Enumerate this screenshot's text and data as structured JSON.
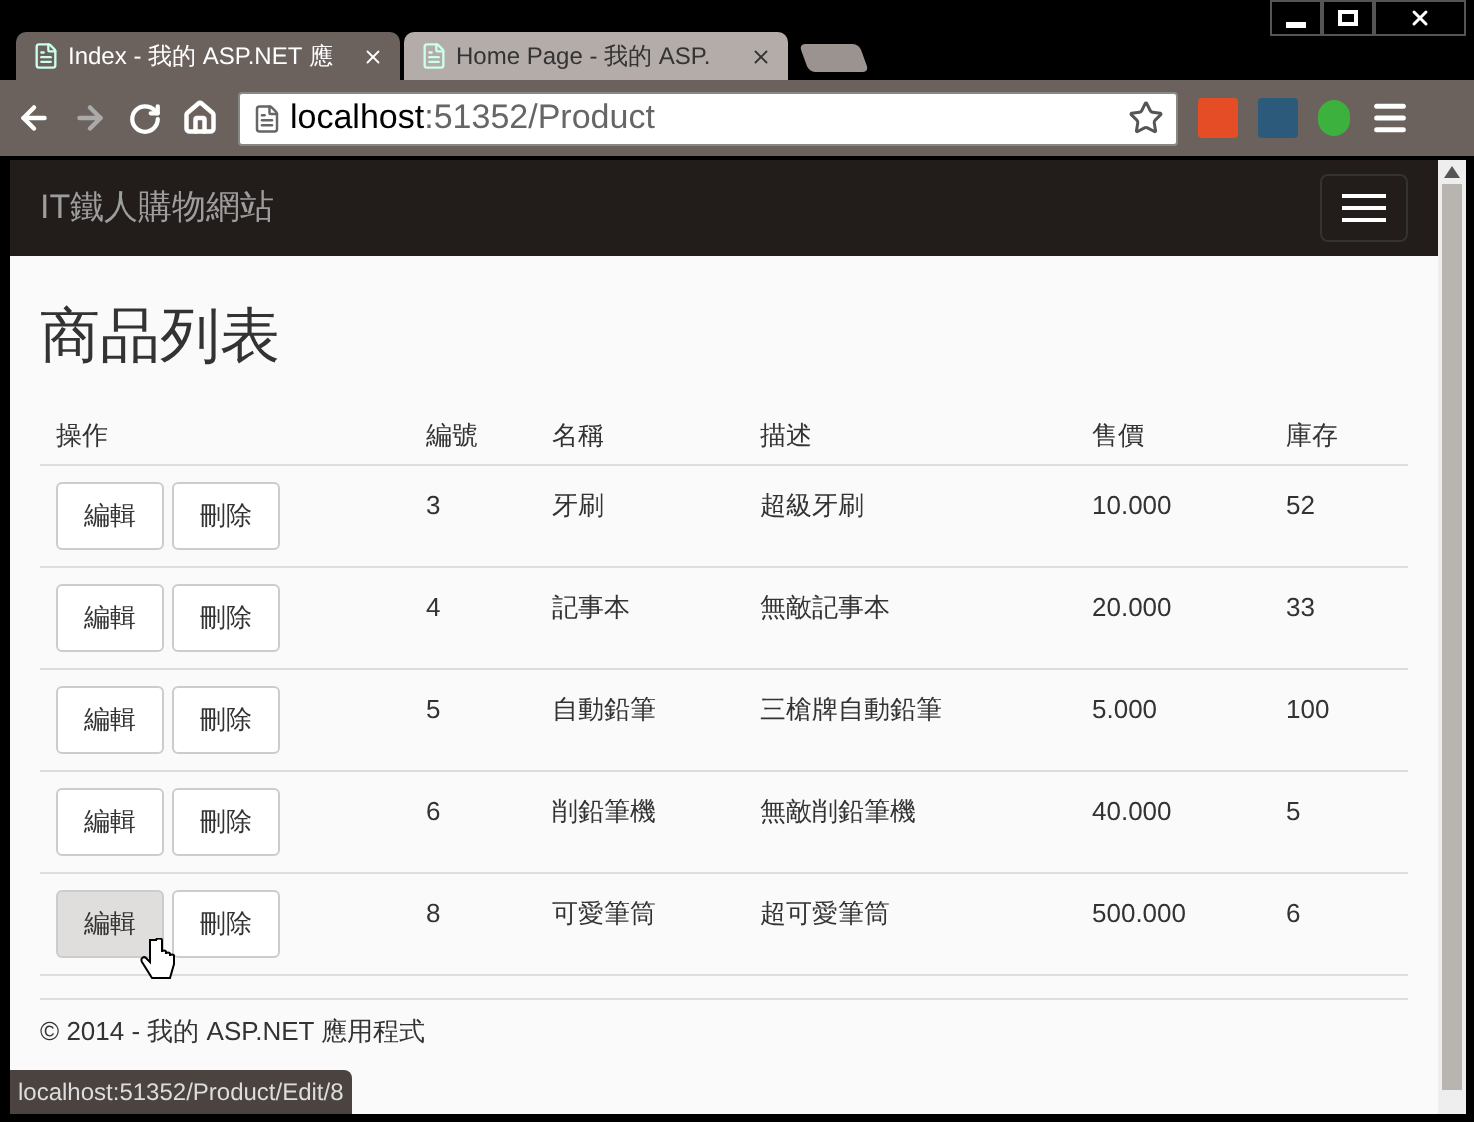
{
  "tabs": [
    {
      "title": "Index - 我的 ASP.NET 應",
      "selected": true
    },
    {
      "title": "Home Page - 我的 ASP.",
      "selected": false
    }
  ],
  "address": {
    "host": "localhost",
    "path": ":51352/Product"
  },
  "navbar": {
    "brand": "IT鐵人購物網站"
  },
  "heading": "商品列表",
  "table": {
    "columns": [
      "操作",
      "編號",
      "名稱",
      "描述",
      "售價",
      "庫存"
    ],
    "rows": [
      {
        "id": "3",
        "name": "牙刷",
        "description": "超級牙刷",
        "price": "10.000",
        "stock": "52",
        "edit": "編輯",
        "delete": "刪除",
        "edit_hovered": false
      },
      {
        "id": "4",
        "name": "記事本",
        "description": "無敵記事本",
        "price": "20.000",
        "stock": "33",
        "edit": "編輯",
        "delete": "刪除",
        "edit_hovered": false
      },
      {
        "id": "5",
        "name": "自動鉛筆",
        "description": "三槍牌自動鉛筆",
        "price": "5.000",
        "stock": "100",
        "edit": "編輯",
        "delete": "刪除",
        "edit_hovered": false
      },
      {
        "id": "6",
        "name": "削鉛筆機",
        "description": "無敵削鉛筆機",
        "price": "40.000",
        "stock": "5",
        "edit": "編輯",
        "delete": "刪除",
        "edit_hovered": false
      },
      {
        "id": "8",
        "name": "可愛筆筒",
        "description": "超可愛筆筒",
        "price": "500.000",
        "stock": "6",
        "edit": "編輯",
        "delete": "刪除",
        "edit_hovered": true
      }
    ]
  },
  "footer": "© 2014 - 我的 ASP.NET 應用程式",
  "status_bar": "localhost:51352/Product/Edit/8"
}
